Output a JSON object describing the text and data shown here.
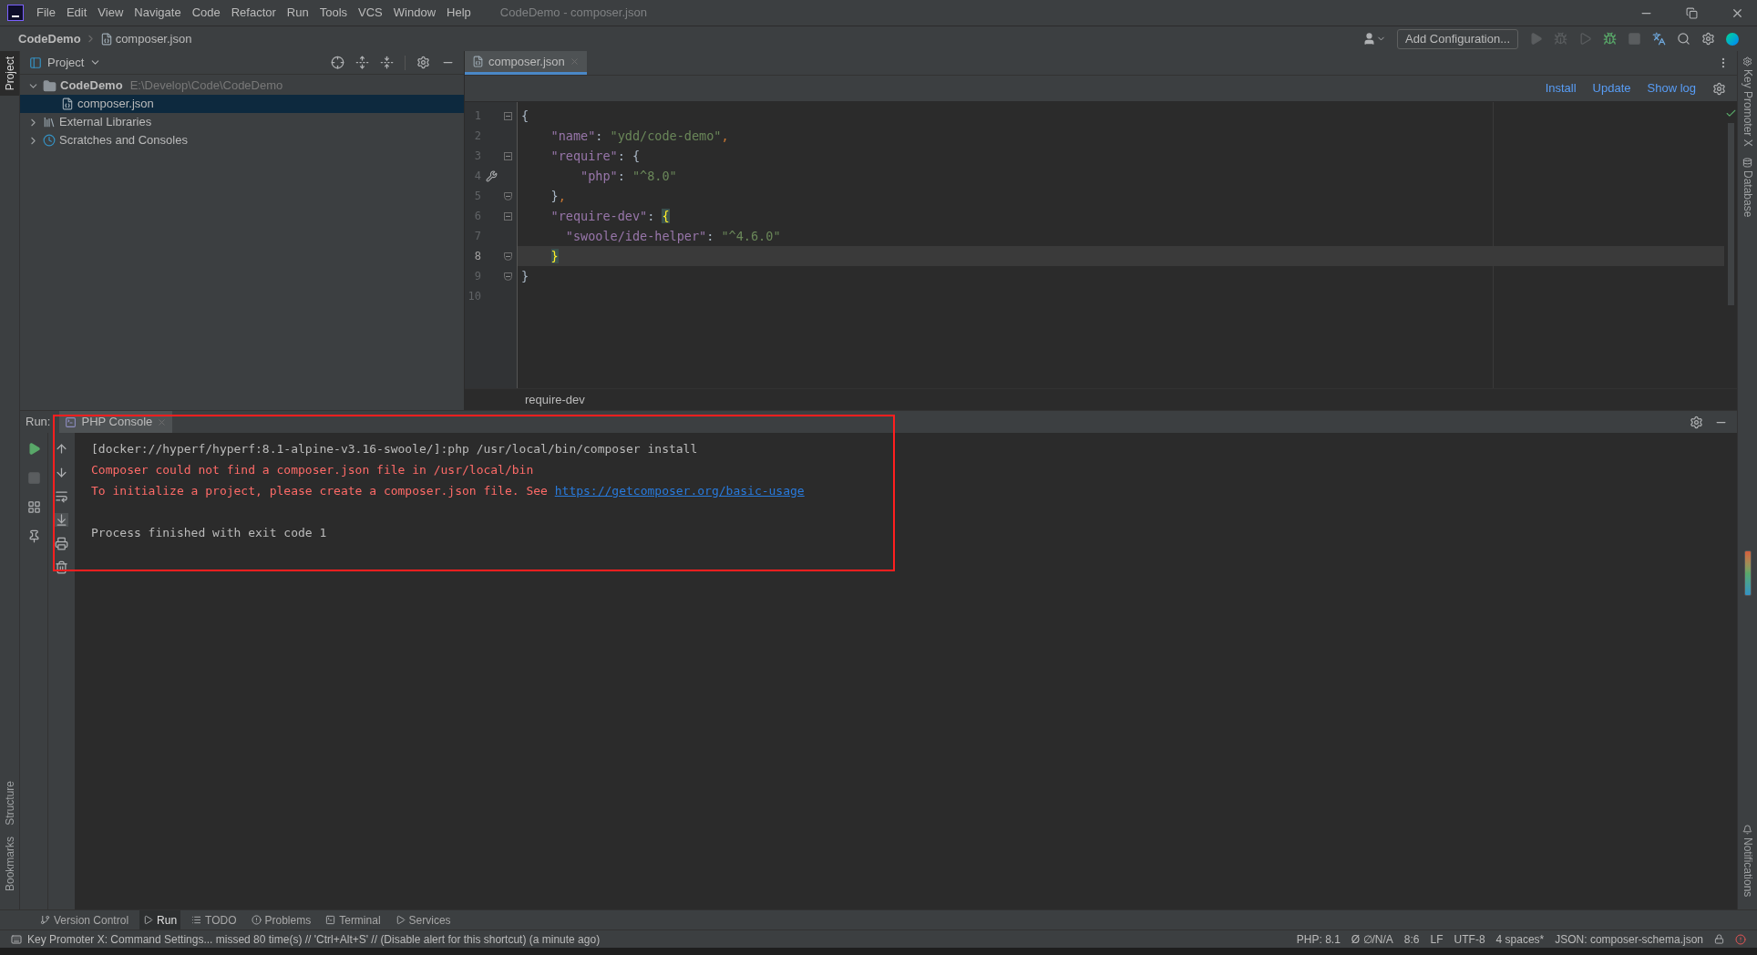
{
  "menu": [
    "File",
    "Edit",
    "View",
    "Navigate",
    "Code",
    "Refactor",
    "Run",
    "Tools",
    "VCS",
    "Window",
    "Help"
  ],
  "window": {
    "title": "CodeDemo - composer.json"
  },
  "breadcrumb": [
    "CodeDemo",
    "composer.json"
  ],
  "toolbar": {
    "run_config": "Add Configuration..."
  },
  "left_stripe": [
    {
      "label": "Project",
      "selected": true
    },
    {
      "label": "Structure",
      "selected": false
    },
    {
      "label": "Bookmarks",
      "selected": false
    }
  ],
  "right_stripe": [
    "Key Promoter X",
    "Database",
    "Notifications"
  ],
  "project": {
    "title": "Project",
    "tree": [
      {
        "kind": "folder",
        "label": "CodeDemo",
        "path": "E:\\Develop\\Code\\CodeDemo",
        "expanded": true,
        "selected": false,
        "children": [
          {
            "kind": "file",
            "label": "composer.json",
            "selected": true
          }
        ]
      },
      {
        "kind": "library",
        "label": "External Libraries",
        "expanded": false,
        "selected": false
      },
      {
        "kind": "scratch",
        "label": "Scratches and Consoles",
        "expanded": false,
        "selected": false
      }
    ]
  },
  "editor": {
    "tabs": [
      {
        "label": "composer.json",
        "selected": true
      }
    ],
    "actions": [
      "Install",
      "Update",
      "Show log"
    ],
    "lines": [
      {
        "number": "1",
        "selected": false,
        "kind": "fold_start",
        "tokens": [
          {
            "kind": "punct",
            "t": "{"
          }
        ]
      },
      {
        "number": "2",
        "selected": false,
        "kind": "plain",
        "tokens": [
          {
            "kind": "key",
            "t": "    \"name\""
          },
          {
            "kind": "punct",
            "t": ": "
          },
          {
            "kind": "string",
            "t": "\"ydd/code-demo\""
          },
          {
            "kind": "comma",
            "t": ","
          }
        ]
      },
      {
        "number": "3",
        "selected": false,
        "kind": "fold_start",
        "tokens": [
          {
            "kind": "key",
            "t": "    \"require\""
          },
          {
            "kind": "punct",
            "t": ": {"
          }
        ]
      },
      {
        "number": "4",
        "selected": false,
        "kind": "tool",
        "tokens": [
          {
            "kind": "key",
            "t": "        \"php\""
          },
          {
            "kind": "punct",
            "t": ": "
          },
          {
            "kind": "string",
            "t": "\"^8.0\""
          }
        ]
      },
      {
        "number": "5",
        "selected": false,
        "kind": "fold_end",
        "tokens": [
          {
            "kind": "punct",
            "t": "    }"
          },
          {
            "kind": "comma",
            "t": ","
          }
        ]
      },
      {
        "number": "6",
        "selected": false,
        "kind": "fold_start",
        "tokens": [
          {
            "kind": "key",
            "t": "    \"require-dev\""
          },
          {
            "kind": "punct",
            "t": ": "
          },
          {
            "kind": "brace",
            "t": "{"
          }
        ]
      },
      {
        "number": "7",
        "selected": false,
        "kind": "plain",
        "tokens": [
          {
            "kind": "key",
            "t": "      \"swoole/ide-helper\""
          },
          {
            "kind": "punct",
            "t": ": "
          },
          {
            "kind": "string",
            "t": "\"^4.6.0\""
          }
        ]
      },
      {
        "number": "8",
        "selected": true,
        "kind": "fold_end",
        "tokens": [
          {
            "kind": "brace",
            "t": "    }"
          }
        ]
      },
      {
        "number": "9",
        "selected": false,
        "kind": "fold_end",
        "tokens": [
          {
            "kind": "punct",
            "t": "}"
          }
        ]
      },
      {
        "number": "10",
        "selected": false,
        "kind": "plain"
      }
    ],
    "breadcrumb": "require-dev"
  },
  "run": {
    "label": "Run:",
    "tabs": [
      {
        "label": "PHP Console",
        "selected": true
      }
    ],
    "output": [
      {
        "kind": "command",
        "text": "[docker://hyperf/hyperf:8.1-alpine-v3.16-swoole/]:php /usr/local/bin/composer install"
      },
      {
        "kind": "error",
        "text": "Composer could not find a composer.json file in /usr/local/bin"
      },
      {
        "kind": "error",
        "text": "To initialize a project, please create a composer.json file. See ",
        "link": "https://getcomposer.org/basic-usage"
      },
      {
        "kind": "blank"
      },
      {
        "kind": "info",
        "text": "Process finished with exit code 1"
      }
    ]
  },
  "tool_tabs": [
    {
      "label": "Version Control",
      "selected": false
    },
    {
      "label": "Run",
      "selected": true
    },
    {
      "label": "TODO",
      "selected": false
    },
    {
      "label": "Problems",
      "selected": false
    },
    {
      "label": "Terminal",
      "selected": false
    },
    {
      "label": "Services",
      "selected": false
    }
  ],
  "status_bar": {
    "message": "Key Promoter X: Command Settings... missed 80 time(s) // 'Ctrl+Alt+S' // (Disable alert for this shortcut) (a minute ago)",
    "items": [
      "PHP: 8.1",
      "Ø ∅/N/A",
      "8:6",
      "LF",
      "UTF-8",
      "4 spaces*",
      "JSON: composer-schema.json"
    ]
  }
}
